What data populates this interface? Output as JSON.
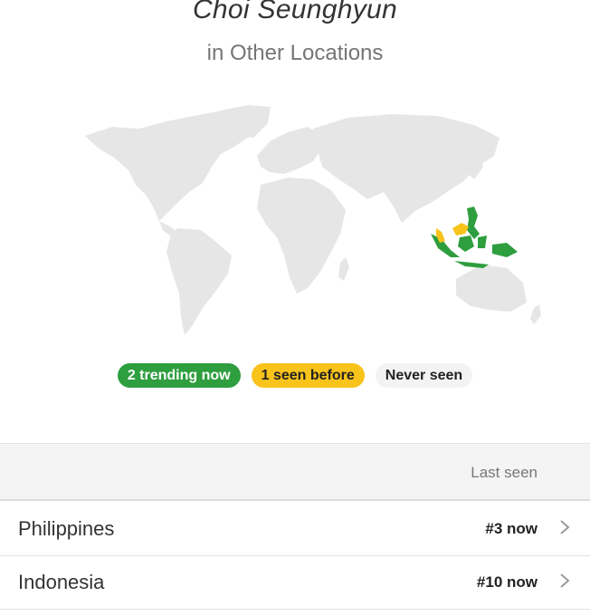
{
  "header": {
    "title": "Choi Seunghyun",
    "subtitle": "in Other Locations"
  },
  "legend": {
    "trending": "2 trending now",
    "seen_before": "1 seen before",
    "never_seen": "Never seen"
  },
  "colors": {
    "trending": "#2e9e3f",
    "seen_before": "#f8c31a",
    "never_seen": "#f3f3f3",
    "land": "#e6e6e6"
  },
  "table": {
    "last_seen_header": "Last seen",
    "rows": [
      {
        "country": "Philippines",
        "rank": "#3 now"
      },
      {
        "country": "Indonesia",
        "rank": "#10 now"
      }
    ]
  }
}
